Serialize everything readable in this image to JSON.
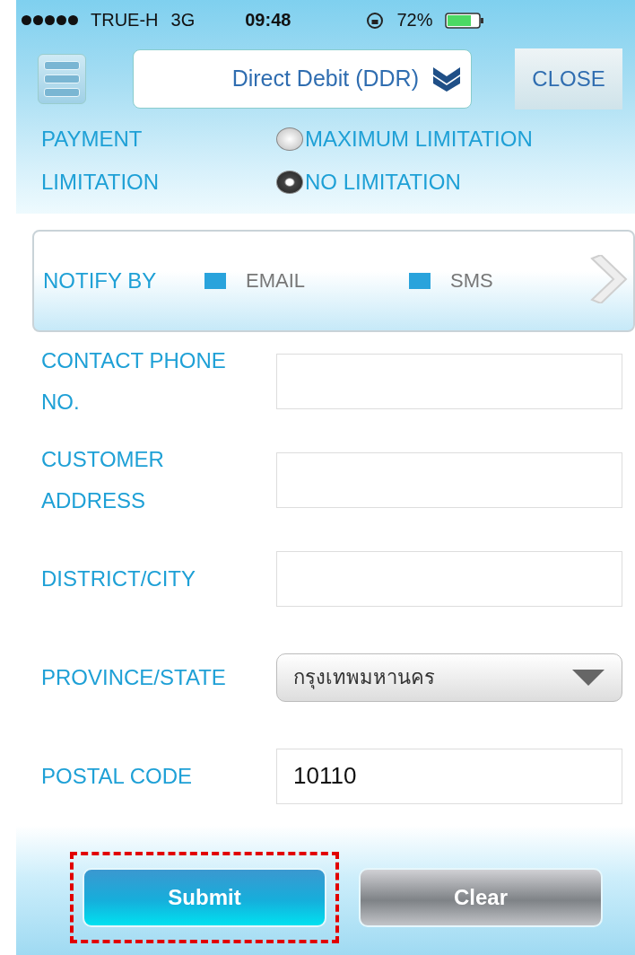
{
  "status_bar": {
    "carrier": "TRUE-H",
    "network": "3G",
    "time": "09:48",
    "battery": "72%"
  },
  "header": {
    "title": "Direct Debit (DDR)",
    "close": "CLOSE"
  },
  "payment_limitation": {
    "label": [
      "PAYMENT",
      "LIMITATION"
    ],
    "options": [
      {
        "label": "MAXIMUM LIMITATION",
        "selected": false
      },
      {
        "label": "NO LIMITATION",
        "selected": true
      }
    ]
  },
  "notify": {
    "label": "NOTIFY BY",
    "options": [
      {
        "label": "EMAIL",
        "checked": true
      },
      {
        "label": "SMS",
        "checked": true
      }
    ]
  },
  "fields": [
    {
      "kind": "text",
      "label": [
        "CONTACT PHONE",
        "NO."
      ]
    },
    {
      "kind": "text",
      "label": [
        "CUSTOMER",
        "ADDRESS"
      ]
    },
    {
      "kind": "text",
      "label": [
        "DISTRICT/CITY"
      ]
    },
    {
      "kind": "select",
      "label": [
        "PROVINCE/STATE"
      ],
      "value": "กรุงเทพมหานคร"
    },
    {
      "kind": "text",
      "label": [
        "POSTAL CODE"
      ],
      "value": "10110"
    }
  ],
  "buttons": [
    {
      "label": "Submit",
      "kind": "primary",
      "highlighted": true
    },
    {
      "label": "Clear",
      "kind": "secondary",
      "highlighted": false
    }
  ]
}
